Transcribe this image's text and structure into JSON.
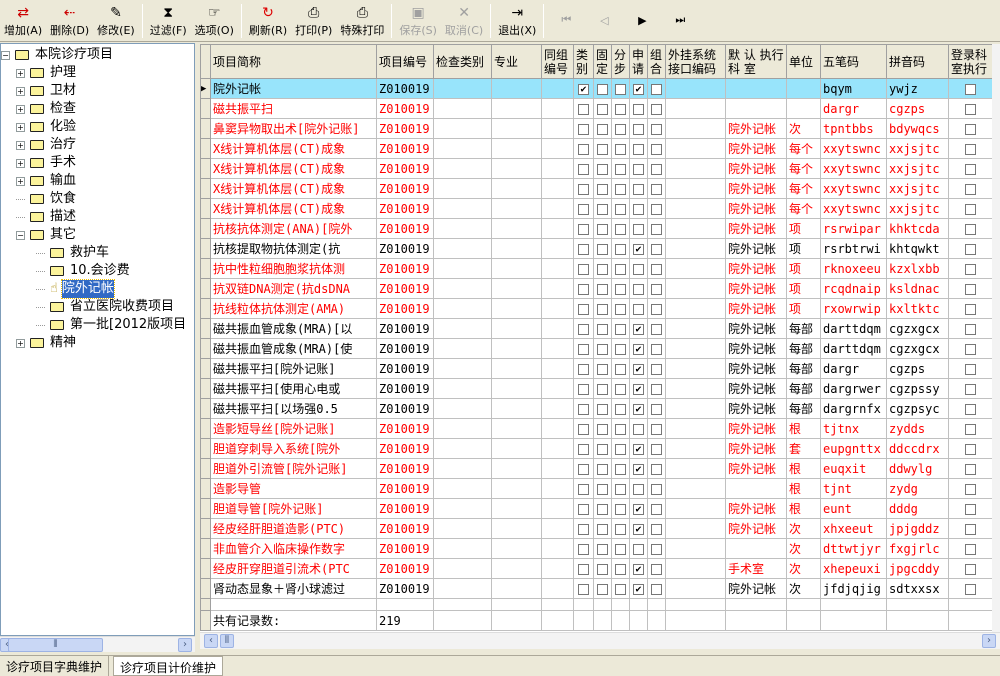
{
  "toolbar": {
    "items": [
      {
        "label": "增加(A)",
        "icon": "add-icon",
        "enabled": true
      },
      {
        "label": "删除(D)",
        "icon": "delete-icon",
        "enabled": true
      },
      {
        "label": "修改(E)",
        "icon": "edit-icon",
        "enabled": true
      },
      {
        "label": "过滤(F)",
        "icon": "hourglass-filter-icon",
        "enabled": true
      },
      {
        "label": "选项(O)",
        "icon": "options-icon",
        "enabled": true
      },
      {
        "label": "刷新(R)",
        "icon": "refresh-icon",
        "enabled": true
      },
      {
        "label": "打印(P)",
        "icon": "printer-icon",
        "enabled": true
      },
      {
        "label": "特殊打印",
        "icon": "printer-icon",
        "enabled": true
      },
      {
        "label": "保存(S)",
        "icon": "save-icon",
        "enabled": false
      },
      {
        "label": "取消(C)",
        "icon": "cancel-icon",
        "enabled": false
      },
      {
        "label": "退出(X)",
        "icon": "exit-door-icon",
        "enabled": true
      }
    ],
    "nav": [
      "first-record-icon",
      "prev-record-icon",
      "next-record-icon",
      "last-record-icon"
    ]
  },
  "tree": {
    "root": "本院诊疗项目",
    "items": [
      {
        "label": "护理",
        "level": 1,
        "expander": "+"
      },
      {
        "label": "卫材",
        "level": 1,
        "expander": "+"
      },
      {
        "label": "检查",
        "level": 1,
        "expander": "+"
      },
      {
        "label": "化验",
        "level": 1,
        "expander": "+"
      },
      {
        "label": "治疗",
        "level": 1,
        "expander": "+"
      },
      {
        "label": "手术",
        "level": 1,
        "expander": "+"
      },
      {
        "label": "输血",
        "level": 1,
        "expander": "+"
      },
      {
        "label": "饮食",
        "level": 1,
        "expander": ""
      },
      {
        "label": "描述",
        "level": 1,
        "expander": ""
      },
      {
        "label": "其它",
        "level": 1,
        "expander": "-"
      },
      {
        "label": "救护车",
        "level": 2,
        "expander": ""
      },
      {
        "label": "10.会诊费",
        "level": 2,
        "expander": ""
      },
      {
        "label": "院外记帐",
        "level": 2,
        "expander": "",
        "selected": true
      },
      {
        "label": "省立医院收费项目",
        "level": 2,
        "expander": ""
      },
      {
        "label": "第一批[2012版项目",
        "level": 2,
        "expander": ""
      },
      {
        "label": "精神",
        "level": 1,
        "expander": "+"
      }
    ]
  },
  "grid": {
    "columns": [
      "项目简称",
      "项目编号",
      "检查类别",
      "专业",
      "同组编号",
      "类别",
      "固定",
      "分步",
      "申请",
      "组合",
      "外挂系统接口编码",
      "默 认 执行 科 室",
      "单位",
      "五笔码",
      "拼音码",
      "登录科室执行"
    ],
    "rows": [
      {
        "name": "院外记帐",
        "code": "Z010019",
        "dept": "",
        "unit": "",
        "wb": "bqym",
        "py": "ywjz",
        "red": false,
        "checks": [
          1,
          0,
          0,
          1,
          0
        ],
        "current": true
      },
      {
        "name": "磁共振平扫",
        "code": "Z010019",
        "dept": "",
        "unit": "",
        "wb": "dargr",
        "py": "cgzps",
        "red": true,
        "checks": [
          0,
          0,
          0,
          0,
          0
        ]
      },
      {
        "name": "鼻窦异物取出术[院外记账]",
        "code": "Z010019",
        "dept": "院外记帐",
        "unit": "次",
        "wb": "tpntbbs",
        "py": "bdywqcs",
        "red": true,
        "checks": [
          0,
          0,
          0,
          0,
          0
        ]
      },
      {
        "name": "X线计算机体层(CT)成象",
        "code": "Z010019",
        "dept": "院外记帐",
        "unit": "每个",
        "wb": "xxytswnc",
        "py": "xxjsjtc",
        "red": true,
        "checks": [
          0,
          0,
          0,
          0,
          0
        ]
      },
      {
        "name": "X线计算机体层(CT)成象",
        "code": "Z010019",
        "dept": "院外记帐",
        "unit": "每个",
        "wb": "xxytswnc",
        "py": "xxjsjtc",
        "red": true,
        "checks": [
          0,
          0,
          0,
          0,
          0
        ]
      },
      {
        "name": "X线计算机体层(CT)成象",
        "code": "Z010019",
        "dept": "院外记帐",
        "unit": "每个",
        "wb": "xxytswnc",
        "py": "xxjsjtc",
        "red": true,
        "checks": [
          0,
          0,
          0,
          0,
          0
        ]
      },
      {
        "name": "X线计算机体层(CT)成象",
        "code": "Z010019",
        "dept": "院外记帐",
        "unit": "每个",
        "wb": "xxytswnc",
        "py": "xxjsjtc",
        "red": true,
        "checks": [
          0,
          0,
          0,
          0,
          0
        ]
      },
      {
        "name": "抗核抗体测定(ANA)[院外",
        "code": "Z010019",
        "dept": "院外记帐",
        "unit": "项",
        "wb": "rsrwipar",
        "py": "khktcda",
        "red": true,
        "checks": [
          0,
          0,
          0,
          0,
          0
        ]
      },
      {
        "name": "抗核提取物抗体测定(抗",
        "code": "Z010019",
        "dept": "院外记帐",
        "unit": "项",
        "wb": "rsrbtrwi",
        "py": "khtqwkt",
        "red": false,
        "checks": [
          0,
          0,
          0,
          1,
          0
        ]
      },
      {
        "name": "抗中性粒细胞胞浆抗体测",
        "code": "Z010019",
        "dept": "院外记帐",
        "unit": "项",
        "wb": "rknoxeeu",
        "py": "kzxlxbb",
        "red": true,
        "checks": [
          0,
          0,
          0,
          0,
          0
        ]
      },
      {
        "name": "抗双链DNA测定(抗dsDNA",
        "code": "Z010019",
        "dept": "院外记帐",
        "unit": "项",
        "wb": "rcqdnaip",
        "py": "ksldnac",
        "red": true,
        "checks": [
          0,
          0,
          0,
          0,
          0
        ]
      },
      {
        "name": "抗线粒体抗体测定(AMA)",
        "code": "Z010019",
        "dept": "院外记帐",
        "unit": "项",
        "wb": "rxowrwip",
        "py": "kxltktc",
        "red": true,
        "checks": [
          0,
          0,
          0,
          0,
          0
        ]
      },
      {
        "name": "磁共振血管成象(MRA)[以",
        "code": "Z010019",
        "dept": "院外记帐",
        "unit": "每部",
        "wb": "darttdqm",
        "py": "cgzxgcx",
        "red": false,
        "checks": [
          0,
          0,
          0,
          1,
          0
        ]
      },
      {
        "name": "磁共振血管成象(MRA)[使",
        "code": "Z010019",
        "dept": "院外记帐",
        "unit": "每部",
        "wb": "darttdqm",
        "py": "cgzxgcx",
        "red": false,
        "checks": [
          0,
          0,
          0,
          1,
          0
        ]
      },
      {
        "name": "磁共振平扫[院外记账]",
        "code": "Z010019",
        "dept": "院外记帐",
        "unit": "每部",
        "wb": "dargr",
        "py": "cgzps",
        "red": false,
        "checks": [
          0,
          0,
          0,
          1,
          0
        ]
      },
      {
        "name": "磁共振平扫[使用心电或",
        "code": "Z010019",
        "dept": "院外记帐",
        "unit": "每部",
        "wb": "dargrwer",
        "py": "cgzpssy",
        "red": false,
        "checks": [
          0,
          0,
          0,
          1,
          0
        ]
      },
      {
        "name": "磁共振平扫[以场强0.5",
        "code": "Z010019",
        "dept": "院外记帐",
        "unit": "每部",
        "wb": "dargrnfx",
        "py": "cgzpsyc",
        "red": false,
        "checks": [
          0,
          0,
          0,
          1,
          0
        ]
      },
      {
        "name": "造影短导丝[院外记账]",
        "code": "Z010019",
        "dept": "院外记帐",
        "unit": "根",
        "wb": "tjtnx",
        "py": "zydds",
        "red": true,
        "checks": [
          0,
          0,
          0,
          0,
          0
        ]
      },
      {
        "name": "胆道穿刺导入系统[院外",
        "code": "Z010019",
        "dept": "院外记帐",
        "unit": "套",
        "wb": "eupgnttx",
        "py": "ddccdrx",
        "red": true,
        "checks": [
          0,
          0,
          0,
          1,
          0
        ]
      },
      {
        "name": "胆道外引流管[院外记账]",
        "code": "Z010019",
        "dept": "院外记帐",
        "unit": "根",
        "wb": "euqxit",
        "py": "ddwylg",
        "red": true,
        "checks": [
          0,
          0,
          0,
          1,
          0
        ]
      },
      {
        "name": "造影导管",
        "code": "Z010019",
        "dept": "",
        "unit": "根",
        "wb": "tjnt",
        "py": "zydg",
        "red": true,
        "checks": [
          0,
          0,
          0,
          0,
          0
        ]
      },
      {
        "name": "胆道导管[院外记账]",
        "code": "Z010019",
        "dept": "院外记帐",
        "unit": "根",
        "wb": "eunt",
        "py": "dddg",
        "red": true,
        "checks": [
          0,
          0,
          0,
          1,
          0
        ]
      },
      {
        "name": "经皮经肝胆道造影(PTC)",
        "code": "Z010019",
        "dept": "院外记帐",
        "unit": "次",
        "wb": "xhxeeut",
        "py": "jpjgddz",
        "red": true,
        "checks": [
          0,
          0,
          0,
          1,
          0
        ]
      },
      {
        "name": "非血管介入临床操作数字",
        "code": "Z010019",
        "dept": "",
        "unit": "次",
        "wb": "dttwtjyr",
        "py": "fxgjrlc",
        "red": true,
        "checks": [
          0,
          0,
          0,
          0,
          0
        ]
      },
      {
        "name": "经皮肝穿胆道引流术(PTC",
        "code": "Z010019",
        "dept": "手术室",
        "unit": "次",
        "wb": "xhepeuxi",
        "py": "jpgcddy",
        "red": true,
        "checks": [
          0,
          0,
          0,
          1,
          0
        ]
      },
      {
        "name": "肾动态显象＋肾小球滤过",
        "code": "Z010019",
        "dept": "院外记帐",
        "unit": "次",
        "wb": "jfdjqjig",
        "py": "sdtxxsx",
        "red": false,
        "checks": [
          0,
          0,
          0,
          1,
          0
        ]
      }
    ],
    "footer": {
      "label": "共有记录数:",
      "count": "219"
    }
  },
  "tabs": [
    {
      "label": "诊疗项目字典维护",
      "active": false
    },
    {
      "label": "诊疗项目计价维护",
      "active": true
    }
  ],
  "colors": {
    "selected_row": "#98e4fb",
    "inactive_text": "#ff0000",
    "tree_selection": "#316ac5"
  }
}
